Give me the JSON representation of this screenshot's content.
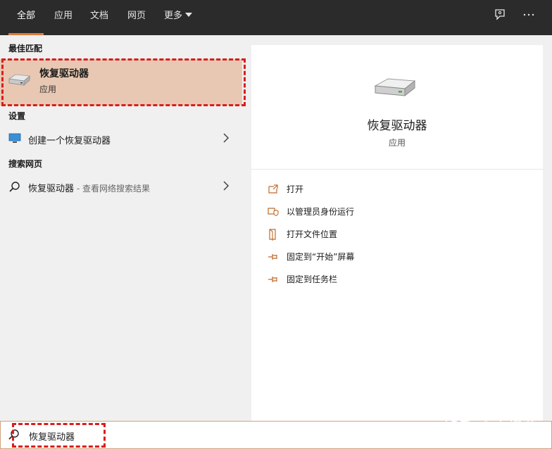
{
  "tabs": [
    {
      "label": "全部",
      "active": true
    },
    {
      "label": "应用"
    },
    {
      "label": "文档"
    },
    {
      "label": "网页"
    },
    {
      "label": "更多"
    }
  ],
  "toolbar": {
    "feedback_icon": "feedback-icon",
    "more_icon": "ellipsis-icon"
  },
  "left": {
    "best_match_header": "最佳匹配",
    "best_match": {
      "title": "恢复驱动器",
      "subtitle": "应用",
      "icon": "drive-icon"
    },
    "settings_header": "设置",
    "settings_item": {
      "label": "创建一个恢复驱动器",
      "icon": "monitor-icon"
    },
    "web_header": "搜索网页",
    "web_item": {
      "label": "恢复驱动器",
      "suffix": " - 查看网络搜索结果",
      "icon": "search-icon"
    }
  },
  "preview": {
    "title": "恢复驱动器",
    "subtitle": "应用",
    "actions": [
      {
        "label": "打开",
        "icon": "open-icon"
      },
      {
        "label": "以管理员身份运行",
        "icon": "admin-shield-icon"
      },
      {
        "label": "打开文件位置",
        "icon": "file-location-icon"
      },
      {
        "label": "固定到“开始”屏幕",
        "icon": "pin-icon"
      },
      {
        "label": "固定到任务栏",
        "icon": "pin-icon"
      }
    ]
  },
  "search": {
    "value": "恢复驱动器"
  },
  "watermark": "知乎 @小怪兽",
  "colors": {
    "accent": "#e07b39",
    "selected": "#e9c8b3",
    "highlight": "#d81e1e",
    "topbar": "#2b2b2b"
  }
}
